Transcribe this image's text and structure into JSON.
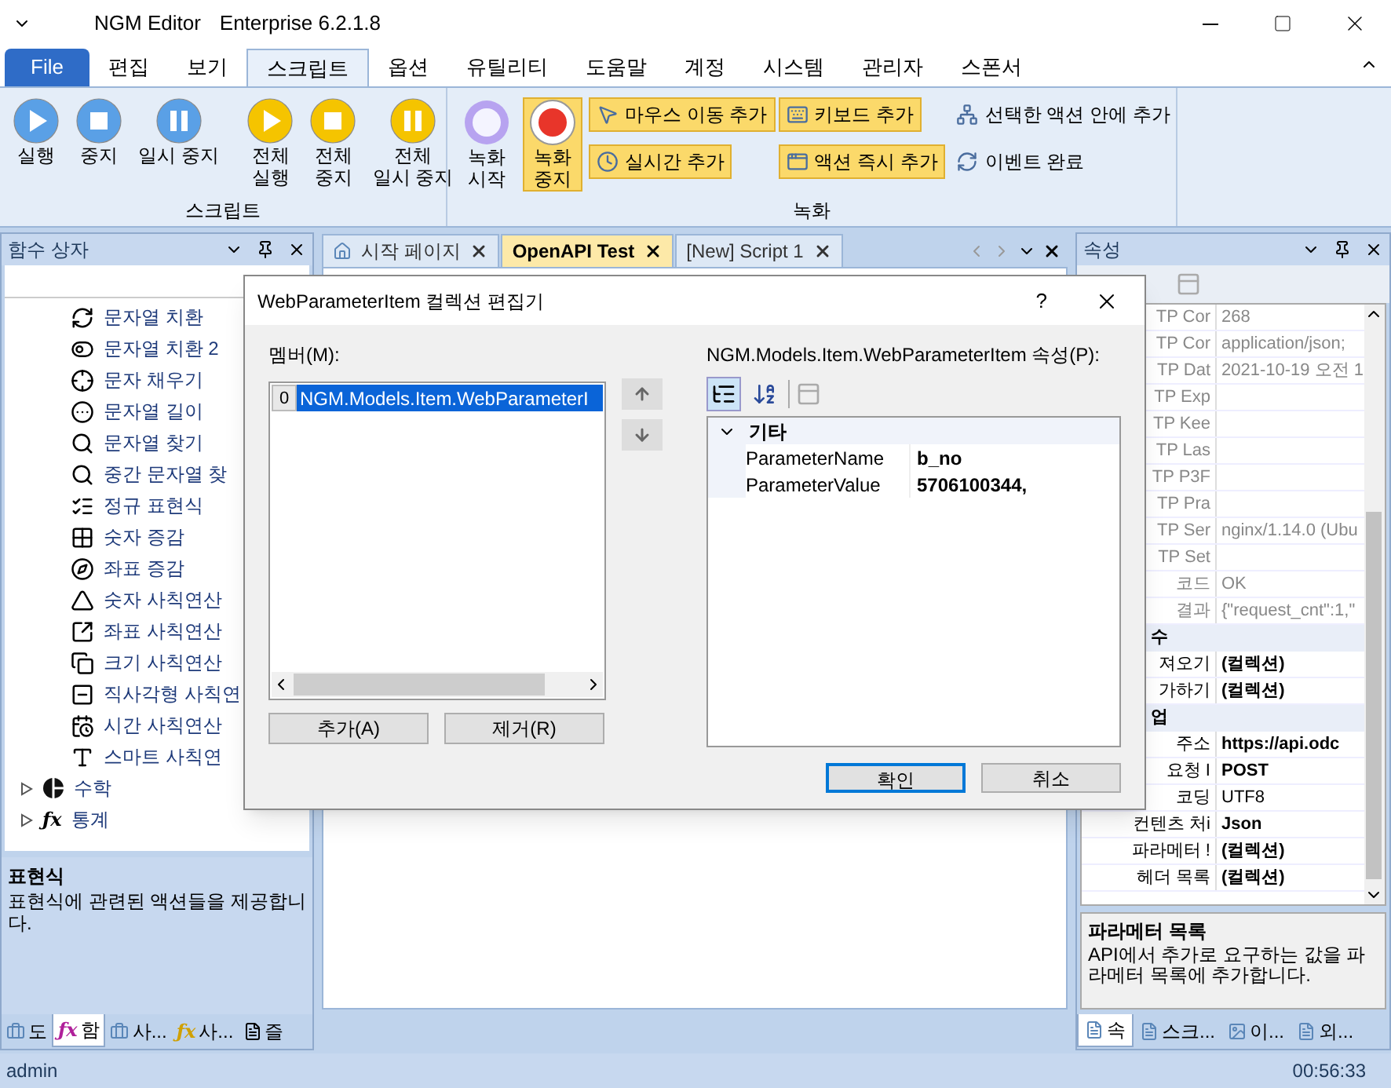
{
  "window": {
    "title": "NGM Editor",
    "edition": "Enterprise 6.2.1.8"
  },
  "menu_tabs": [
    {
      "label": "File",
      "kind": "file",
      "selected": false
    },
    {
      "label": "편집",
      "kind": "tab",
      "selected": false
    },
    {
      "label": "보기",
      "kind": "tab",
      "selected": false
    },
    {
      "label": "스크립트",
      "kind": "tab",
      "selected": true
    },
    {
      "label": "옵션",
      "kind": "tab",
      "selected": false
    },
    {
      "label": "유틸리티",
      "kind": "tab",
      "selected": false
    },
    {
      "label": "도움말",
      "kind": "tab",
      "selected": false
    },
    {
      "label": "계정",
      "kind": "tab",
      "selected": false
    },
    {
      "label": "시스템",
      "kind": "tab",
      "selected": false
    },
    {
      "label": "관리자",
      "kind": "tab",
      "selected": false
    },
    {
      "label": "스폰서",
      "kind": "tab",
      "selected": false
    }
  ],
  "ribbon": {
    "script_group": {
      "label": "스크립트",
      "buttons": [
        {
          "label": "실행",
          "kind": "play",
          "color": "#5aa0e6",
          "active": false
        },
        {
          "label": "중지",
          "kind": "stop",
          "color": "#5aa0e6",
          "active": false
        },
        {
          "label": "일시 중지",
          "kind": "pause",
          "color": "#5aa0e6",
          "active": false
        },
        {
          "label": "전체\n실행",
          "kind": "play",
          "color": "#f5c400",
          "active": false
        },
        {
          "label": "전체\n중지",
          "kind": "stop",
          "color": "#f5c400",
          "active": false
        },
        {
          "label": "전체\n일시 중지",
          "kind": "pause",
          "color": "#f5c400",
          "active": false
        }
      ]
    },
    "record_group": {
      "label": "녹화",
      "buttons": [
        {
          "label": "녹화\n시작",
          "kind": "record_start",
          "active": false
        },
        {
          "label": "녹화\n중지",
          "kind": "record_stop",
          "active": true
        }
      ],
      "small_buttons": [
        {
          "label": "마우스 이동 추가",
          "kind": "mouse",
          "active": true
        },
        {
          "label": "키보드 추가",
          "kind": "keyboard",
          "active": true
        },
        {
          "label": "선택한 액션 안에 추가",
          "kind": "tree",
          "active": false
        },
        {
          "label": "실시간 추가",
          "kind": "clock",
          "active": true
        },
        {
          "label": "액션 즉시 추가",
          "kind": "window",
          "active": true
        },
        {
          "label": "이벤트 완료",
          "kind": "refresh",
          "active": false
        }
      ]
    }
  },
  "function_box": {
    "title": "함수 상자",
    "items": [
      {
        "label": "문자열 치환"
      },
      {
        "label": "문자열 치환 2"
      },
      {
        "label": "문자 채우기"
      },
      {
        "label": "문자열 길이"
      },
      {
        "label": "문자열 찾기"
      },
      {
        "label": "중간 문자열 찾"
      },
      {
        "label": "정규 표현식"
      },
      {
        "label": "숫자 증감"
      },
      {
        "label": "좌표 증감"
      },
      {
        "label": "숫자 사칙연산"
      },
      {
        "label": "좌표 사칙연산"
      },
      {
        "label": "크기 사칙연산"
      },
      {
        "label": "직사각형 사칙연"
      },
      {
        "label": "시간 사칙연산"
      },
      {
        "label": "스마트 사칙연"
      }
    ],
    "groups": [
      {
        "label": "수학",
        "expanded": false
      },
      {
        "label": "통계",
        "expanded": false,
        "icon": "ƒx"
      }
    ],
    "description_title": "표현식",
    "description": "표현식에 관련된 액션들을 제공합니다.",
    "tabs": [
      {
        "label": "도",
        "selected": false
      },
      {
        "label": "함",
        "selected": true,
        "icon": "ƒx"
      },
      {
        "label": "사...",
        "selected": false
      },
      {
        "label": "사...",
        "selected": false,
        "icon": "ƒx"
      },
      {
        "label": "즐",
        "selected": false
      }
    ]
  },
  "document_tabs": [
    {
      "label": "시작 페이지",
      "selected": false
    },
    {
      "label": "OpenAPI Test",
      "selected": true
    },
    {
      "label": "[New] Script 1",
      "selected": false
    }
  ],
  "properties": {
    "title": "속성",
    "rows": [
      {
        "kind": "property",
        "name": "TP Cor",
        "value": "268",
        "readonly": true
      },
      {
        "kind": "property",
        "name": "TP Cor",
        "value": "application/json;",
        "readonly": true
      },
      {
        "kind": "property",
        "name": "TP Dat",
        "value": "2021-10-19 오전 1",
        "readonly": true
      },
      {
        "kind": "property",
        "name": "TP Exp",
        "readonly": true
      },
      {
        "kind": "property",
        "name": "TP Kee",
        "readonly": true
      },
      {
        "kind": "property",
        "name": "TP Las",
        "readonly": true
      },
      {
        "kind": "property",
        "name": "TP P3F",
        "readonly": true
      },
      {
        "kind": "property",
        "name": "TP Pra",
        "readonly": true
      },
      {
        "kind": "property",
        "name": "TP Ser",
        "value": "nginx/1.14.0 (Ubu",
        "readonly": true
      },
      {
        "kind": "property",
        "name": "TP Set",
        "readonly": true
      },
      {
        "kind": "property",
        "name": "코드",
        "value": "OK",
        "readonly": true
      },
      {
        "kind": "property",
        "name": "결과",
        "value": "{\"request_cnt\":1,\"",
        "readonly": true
      },
      {
        "kind": "category",
        "name": "수"
      },
      {
        "kind": "property",
        "name": "져오기",
        "value": "(컬렉션)",
        "readonly": false,
        "modified": true
      },
      {
        "kind": "property",
        "name": "가하기",
        "value": "(컬렉션)",
        "readonly": false,
        "modified": true
      },
      {
        "kind": "category",
        "name": "업"
      },
      {
        "kind": "property",
        "name": "주소",
        "value": "https://api.odc",
        "readonly": false,
        "modified": true
      },
      {
        "kind": "property",
        "name": "요청 I",
        "value": "POST",
        "readonly": false,
        "modified": true
      },
      {
        "kind": "property",
        "name": "코딩",
        "value": "UTF8",
        "readonly": false,
        "modified": false
      },
      {
        "kind": "property",
        "name": "컨텐츠 처i",
        "value": "Json",
        "readonly": false,
        "modified": true
      },
      {
        "kind": "property",
        "name": "파라메터 !",
        "value": "(컬렉션)",
        "readonly": false,
        "modified": true
      },
      {
        "kind": "property",
        "name": "헤더 목록",
        "value": "(컬렉션)",
        "readonly": false,
        "modified": true
      }
    ],
    "description_title": "파라메터 목록",
    "description": "API에서 추가로 요구하는 값을 파라메터 목록에 추가합니다.",
    "tabs": [
      {
        "label": "속",
        "selected": true
      },
      {
        "label": "스크...",
        "selected": false
      },
      {
        "label": "이...",
        "selected": false
      },
      {
        "label": "외...",
        "selected": false
      }
    ]
  },
  "dialog": {
    "title": "WebParameterItem 컬렉션 편집기",
    "help": "?",
    "members_label": "멤버(M):",
    "members": [
      {
        "index": "0",
        "label": "NGM.Models.Item.WebParameterI",
        "selected": true
      }
    ],
    "add_button": "추가(A)",
    "remove_button": "제거(R)",
    "properties_label": "NGM.Models.Item.WebParameterItem 속성(P):",
    "category": {
      "label": "기타",
      "expanded": true
    },
    "rows": [
      {
        "name": "ParameterName",
        "value": "b_no"
      },
      {
        "name": "ParameterValue",
        "value": "5706100344,"
      }
    ],
    "ok_button": "확인",
    "cancel_button": "취소"
  },
  "status_bar": {
    "user": "admin",
    "time": "00:56:33"
  }
}
